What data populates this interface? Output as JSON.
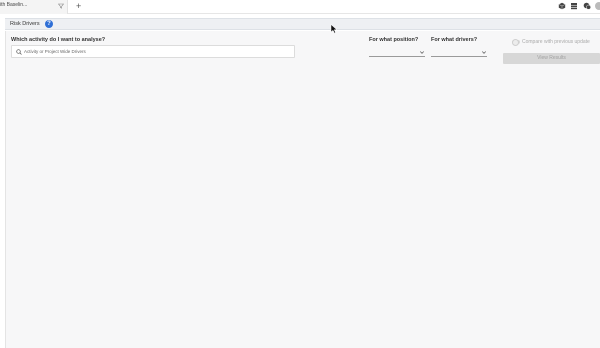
{
  "tabs": [
    {
      "label": "ith Baselin..."
    }
  ],
  "tabbar": {
    "add_label": "+"
  },
  "section": {
    "title": "Risk Drivers",
    "help_label": "?"
  },
  "form": {
    "activity_label": "Which activity do I want to analyse?",
    "activity_placeholder": "Activity or Project Wide Drivers",
    "position_label": "For what position?",
    "position_value": "",
    "drivers_label": "For what drivers?",
    "drivers_value": "",
    "compare_label": "Compare with previous update",
    "compare_enabled": false,
    "view_results_label": "View Results"
  },
  "colors": {
    "accent": "#2f6fd6",
    "header_bg": "#eef0f3",
    "panel_bg": "#f7f7f8",
    "disabled_button": "#d7d7d7"
  },
  "icons": [
    "filter-icon",
    "box-icon",
    "stack-icon",
    "chat-icon",
    "avatar-icon",
    "search-icon",
    "chevron-down-icon",
    "help-icon",
    "mouse-cursor-icon"
  ]
}
